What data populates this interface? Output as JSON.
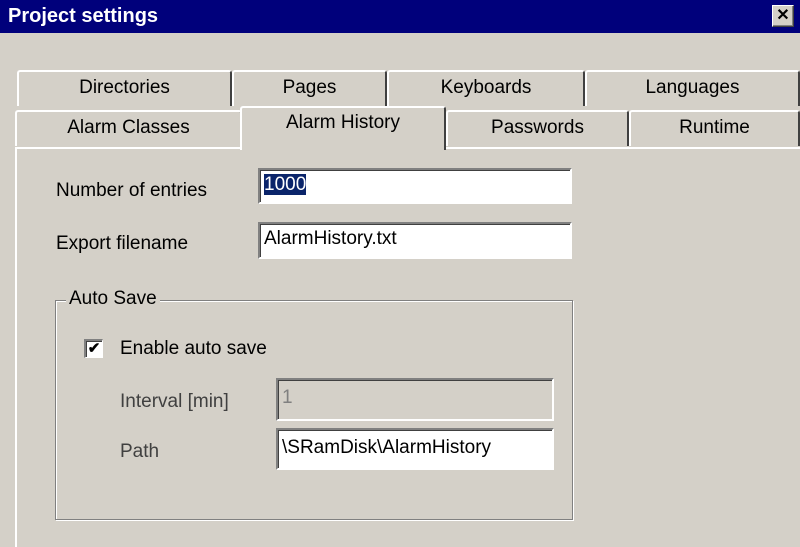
{
  "window": {
    "title": "Project settings",
    "close_glyph": "✕"
  },
  "tabs": {
    "row_back": [
      "Directories",
      "Pages",
      "Keyboards",
      "Languages"
    ],
    "row_front": [
      "Alarm Classes",
      "Alarm History",
      "Passwords",
      "Runtime"
    ],
    "active": "Alarm History"
  },
  "form": {
    "entries_label": "Number of entries",
    "entries_value": "1000",
    "export_label": "Export filename",
    "export_value": "AlarmHistory.txt"
  },
  "auto_save": {
    "group_title": "Auto Save",
    "enable_label": "Enable auto save",
    "enable_checked": true,
    "check_glyph": "✔",
    "interval_label": "Interval [min]",
    "interval_value": "1",
    "path_label": "Path",
    "path_value": "\\SRamDisk\\AlarmHistory"
  }
}
